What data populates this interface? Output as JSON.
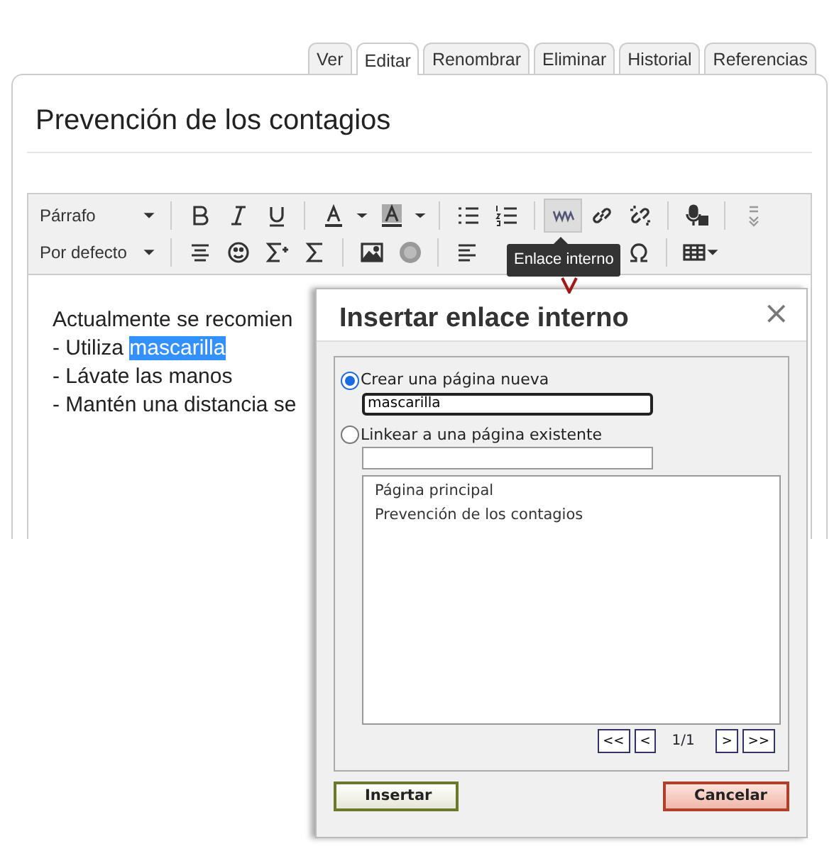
{
  "tabs": [
    {
      "label": "Ver",
      "selected": false
    },
    {
      "label": "Editar",
      "selected": true
    },
    {
      "label": "Renombrar",
      "selected": false
    },
    {
      "label": "Eliminar",
      "selected": false
    },
    {
      "label": "Historial",
      "selected": false
    },
    {
      "label": "Referencias",
      "selected": false
    }
  ],
  "page_title": "Prevención de los contagios",
  "editor": {
    "block_format": "Párrafo",
    "font": "Por defecto",
    "internal_link_pressed": true,
    "tooltip": "Enlace interno",
    "lines": [
      [
        {
          "text": "Actualmente se recomien",
          "selected": false
        }
      ],
      [
        {
          "text": "- Utiliza ",
          "selected": false
        },
        {
          "text": "mascarilla",
          "selected": true
        }
      ],
      [
        {
          "text": "- Lávate las manos",
          "selected": false
        }
      ],
      [
        {
          "text": "- Mantén una distancia se",
          "selected": false
        }
      ]
    ]
  },
  "dialog": {
    "title": "Insertar enlace interno",
    "close": "×",
    "options": [
      {
        "label": "Crear una página nueva",
        "selected": true,
        "value": "mascarilla"
      },
      {
        "label": "Linkear a una página existente",
        "selected": false
      }
    ],
    "pages": [
      "Página principal",
      "Prevención de los contagios"
    ],
    "pager": {
      "first": "<<",
      "prev": "<",
      "page": "1/1",
      "next": ">",
      "last": ">>"
    },
    "buttons": [
      {
        "label": "Insertar",
        "kind": "confirm"
      },
      {
        "label": "Cancelar",
        "kind": "cancel"
      }
    ]
  }
}
